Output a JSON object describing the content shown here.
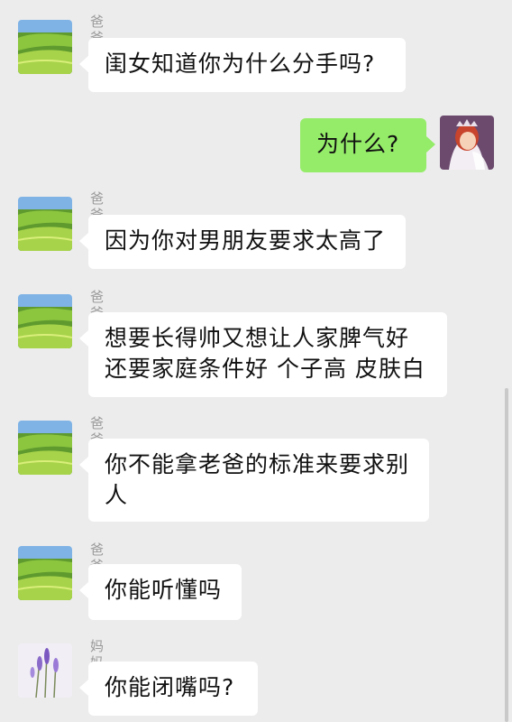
{
  "messages": [
    {
      "sender": "爸爸",
      "side": "left",
      "avatar": "green-field-avatar-icon",
      "lines": [
        "闺女知道你为什么分手吗?"
      ]
    },
    {
      "sender": "",
      "side": "right",
      "avatar": "princess-avatar-icon",
      "lines": [
        "为什么?"
      ]
    },
    {
      "sender": "爸爸",
      "side": "left",
      "avatar": "green-field-avatar-icon",
      "lines": [
        "因为你对男朋友要求太高了"
      ]
    },
    {
      "sender": "爸爸",
      "side": "left",
      "avatar": "green-field-avatar-icon",
      "lines": [
        "想要长得帅又想让人家脾气好",
        "还要家庭条件好 个子高 皮肤白"
      ]
    },
    {
      "sender": "爸爸",
      "side": "left",
      "avatar": "green-field-avatar-icon",
      "lines": [
        "你不能拿老爸的标准来要求别",
        "人"
      ]
    },
    {
      "sender": "爸爸",
      "side": "left",
      "avatar": "green-field-avatar-icon",
      "lines": [
        "你能听懂吗"
      ]
    },
    {
      "sender": "妈妈",
      "side": "left",
      "avatar": "lavender-avatar-icon",
      "lines": [
        "你能闭嘴吗?"
      ]
    }
  ],
  "colors": {
    "background": "#ececec",
    "bubble_incoming": "#ffffff",
    "bubble_outgoing": "#95ec69",
    "sender_name": "#9a9a9a"
  }
}
